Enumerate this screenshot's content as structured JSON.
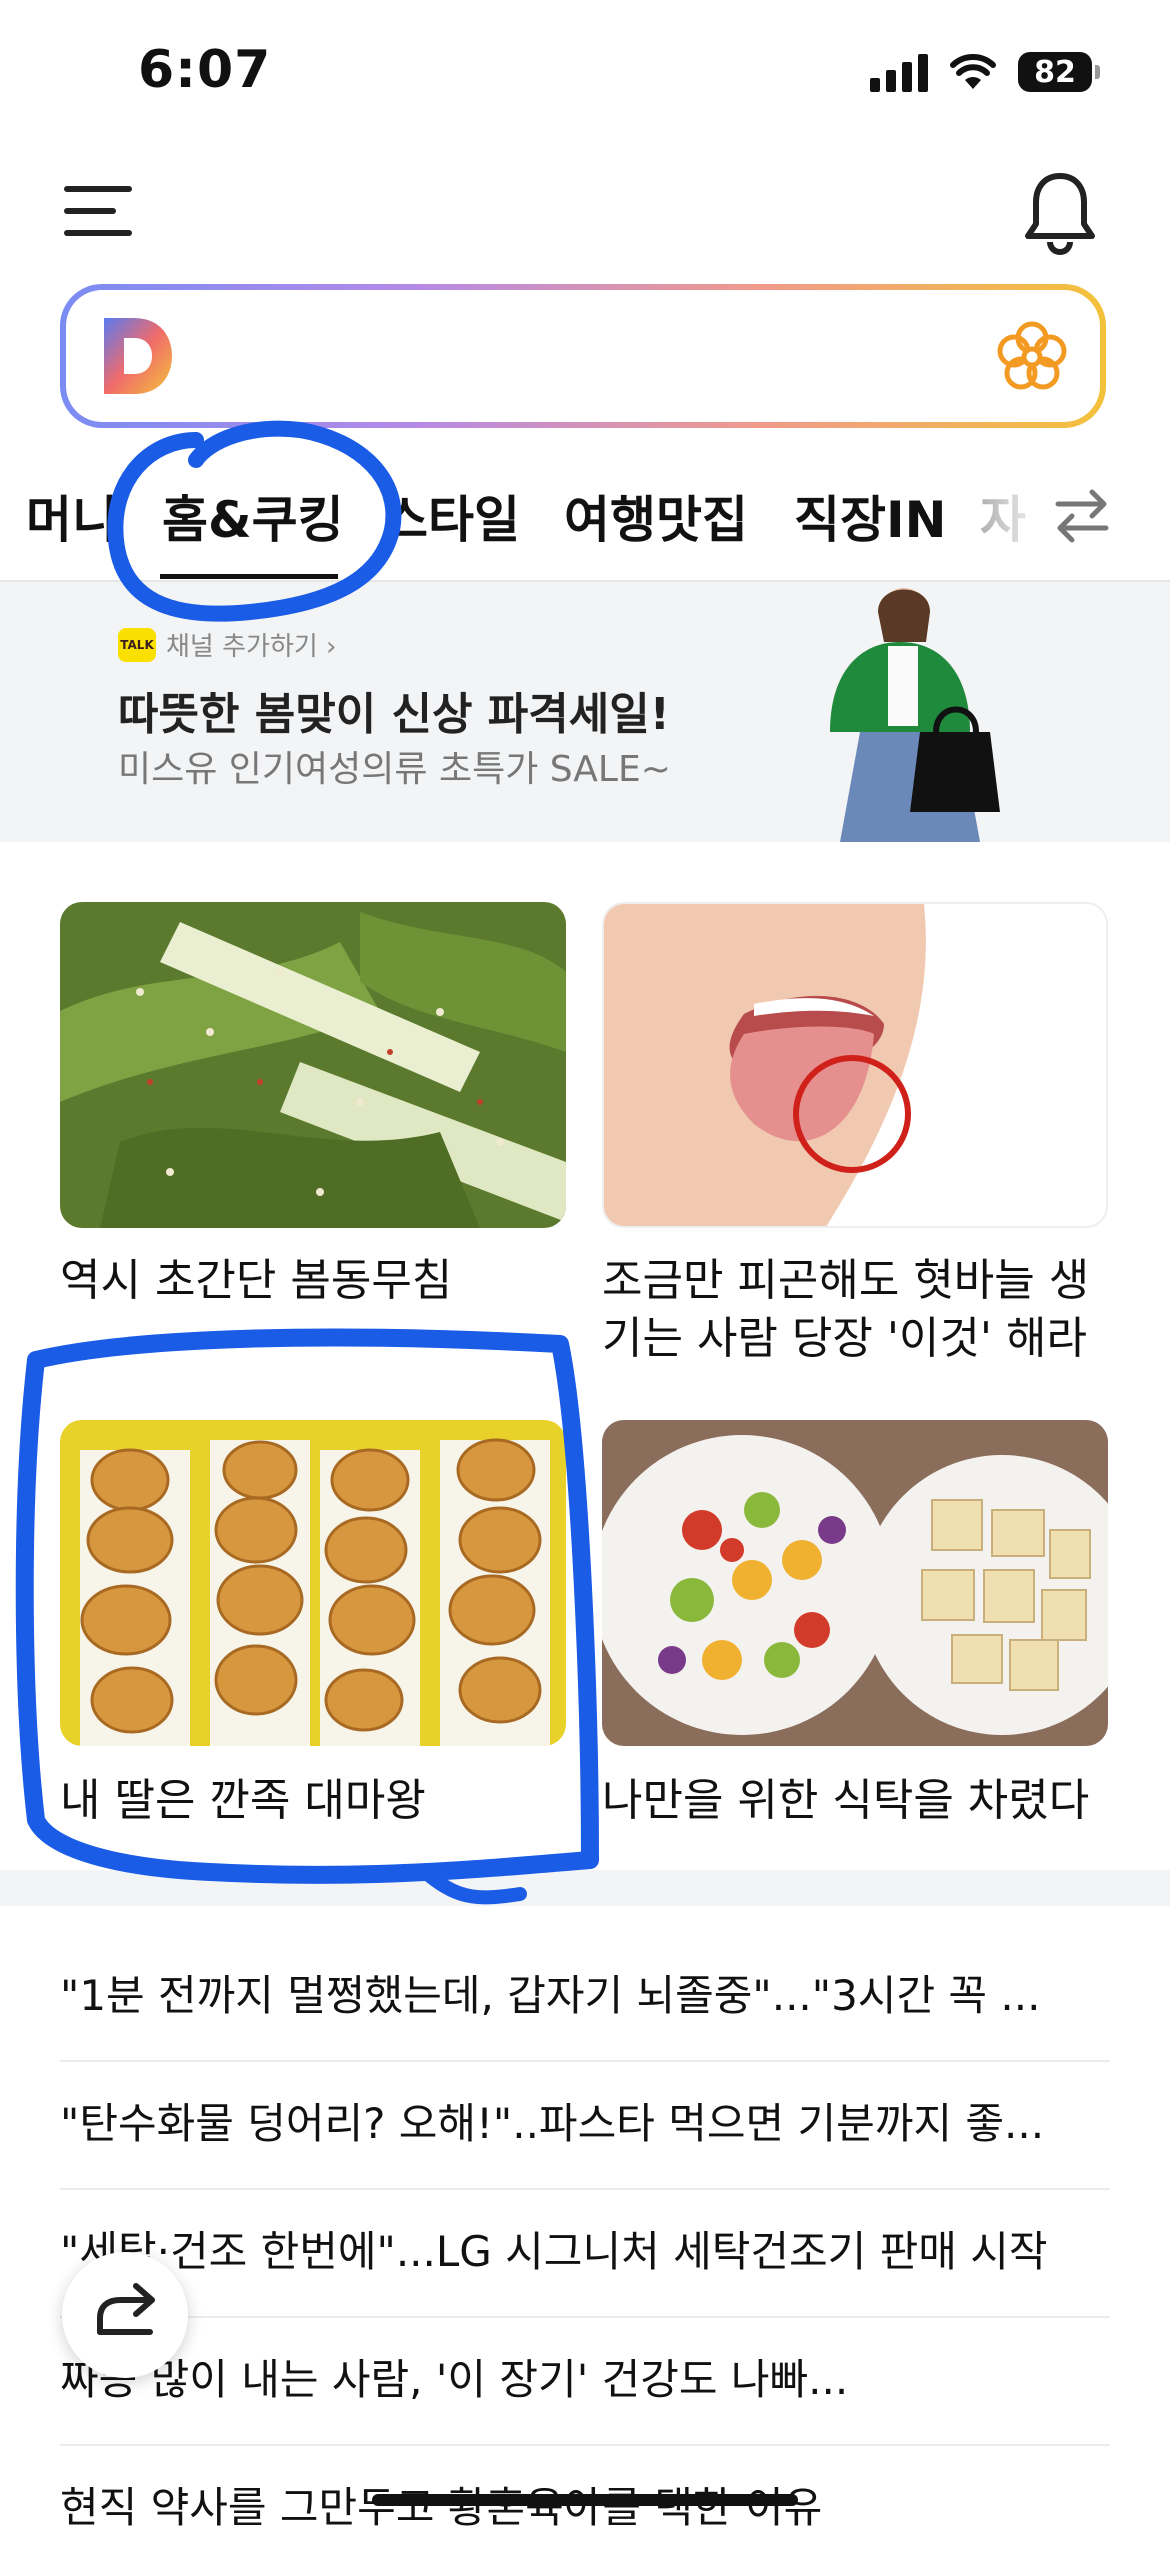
{
  "status_bar": {
    "time": "6:07",
    "battery": "82"
  },
  "tabs": [
    "머니",
    "홈&쿠킹",
    "스타일",
    "여행맛집",
    "직장IN",
    "자"
  ],
  "active_tab": "홈&쿠킹",
  "ad": {
    "channel_label": "채널 추가하기 ›",
    "title": "따뜻한 봄맞이 신상 파격세일!",
    "subtitle": "미스유 인기여성의류 초특가 SALE~"
  },
  "cards": [
    {
      "caption": "역시 초간단 봄동무침"
    },
    {
      "caption": "조금만 피곤해도 혓바늘 생기는 사람 당장 '이것' 해라"
    },
    {
      "caption": "내 딸은 깐족 대마왕"
    },
    {
      "caption": "나만을 위한 식탁을 차렸다"
    }
  ],
  "news": [
    "\"1분 전까지 멀쩡했는데, 갑자기 뇌졸중\"...\"3시간 꼭 ...",
    "\"탄수화물 덩어리? 오해!\"..파스타 먹으면 기분까지 좋...",
    "\"세탁·건조 한번에\"...LG 시그니처 세탁건조기 판매 시작",
    "짜증 많이 내는 사람, '이 장기' 건강도 나빠...",
    "현직 약사를 그만두고 황혼육아를 택한 이유"
  ],
  "colors": {
    "annotation": "#1a5ce6",
    "search_gradient": [
      "#7a8cf2",
      "#f3c23a"
    ],
    "kakao": "#f9e000"
  }
}
